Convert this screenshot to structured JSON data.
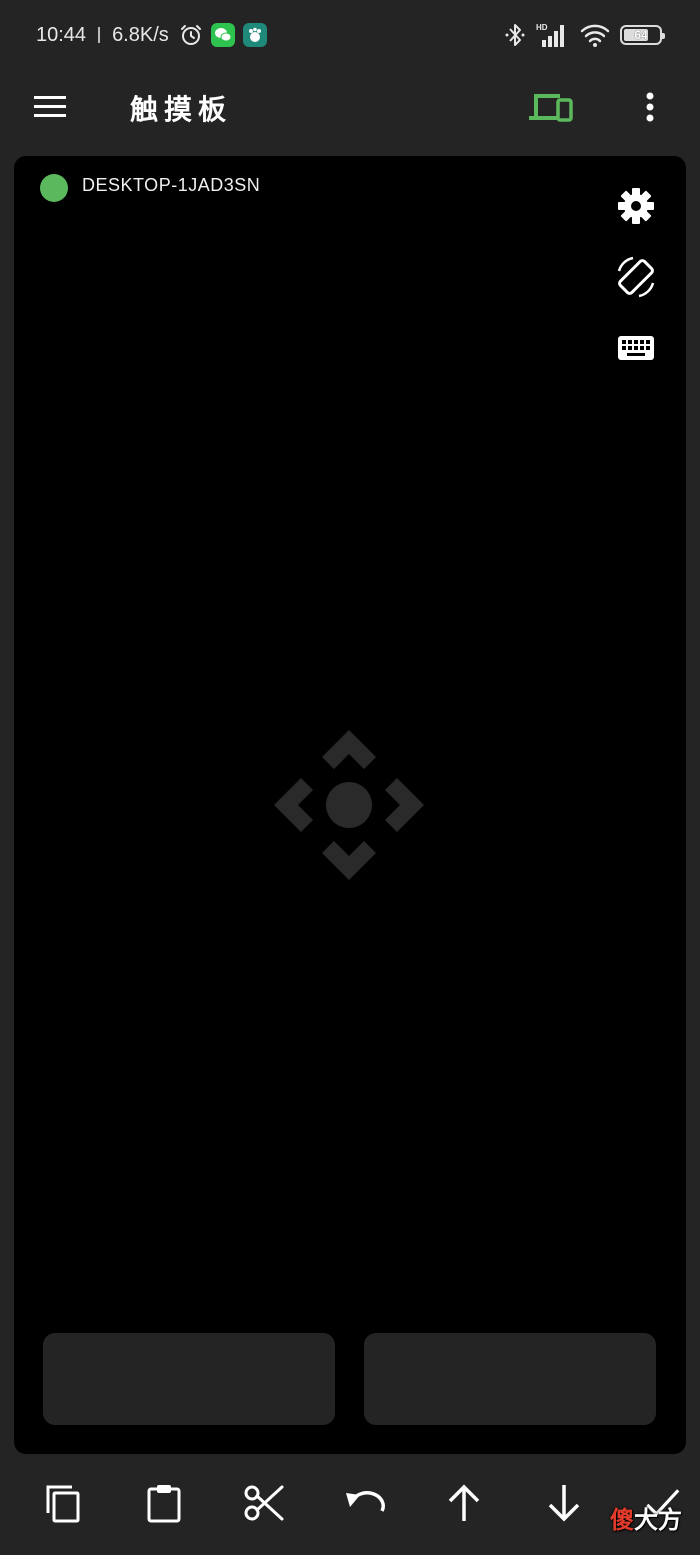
{
  "status_bar": {
    "time": "10:44",
    "net_speed": "6.8K/s",
    "battery": "64",
    "signal_label": "HD"
  },
  "toolbar": {
    "title": "触摸板"
  },
  "touchpad": {
    "device_name": "DESKTOP-1JAD3SN",
    "connection_color": "#5cb85c"
  },
  "watermark": {
    "part1": "傻",
    "part2": "大方"
  },
  "colors": {
    "accent": "#5cb85c",
    "background": "#242424",
    "pad": "#000000"
  }
}
